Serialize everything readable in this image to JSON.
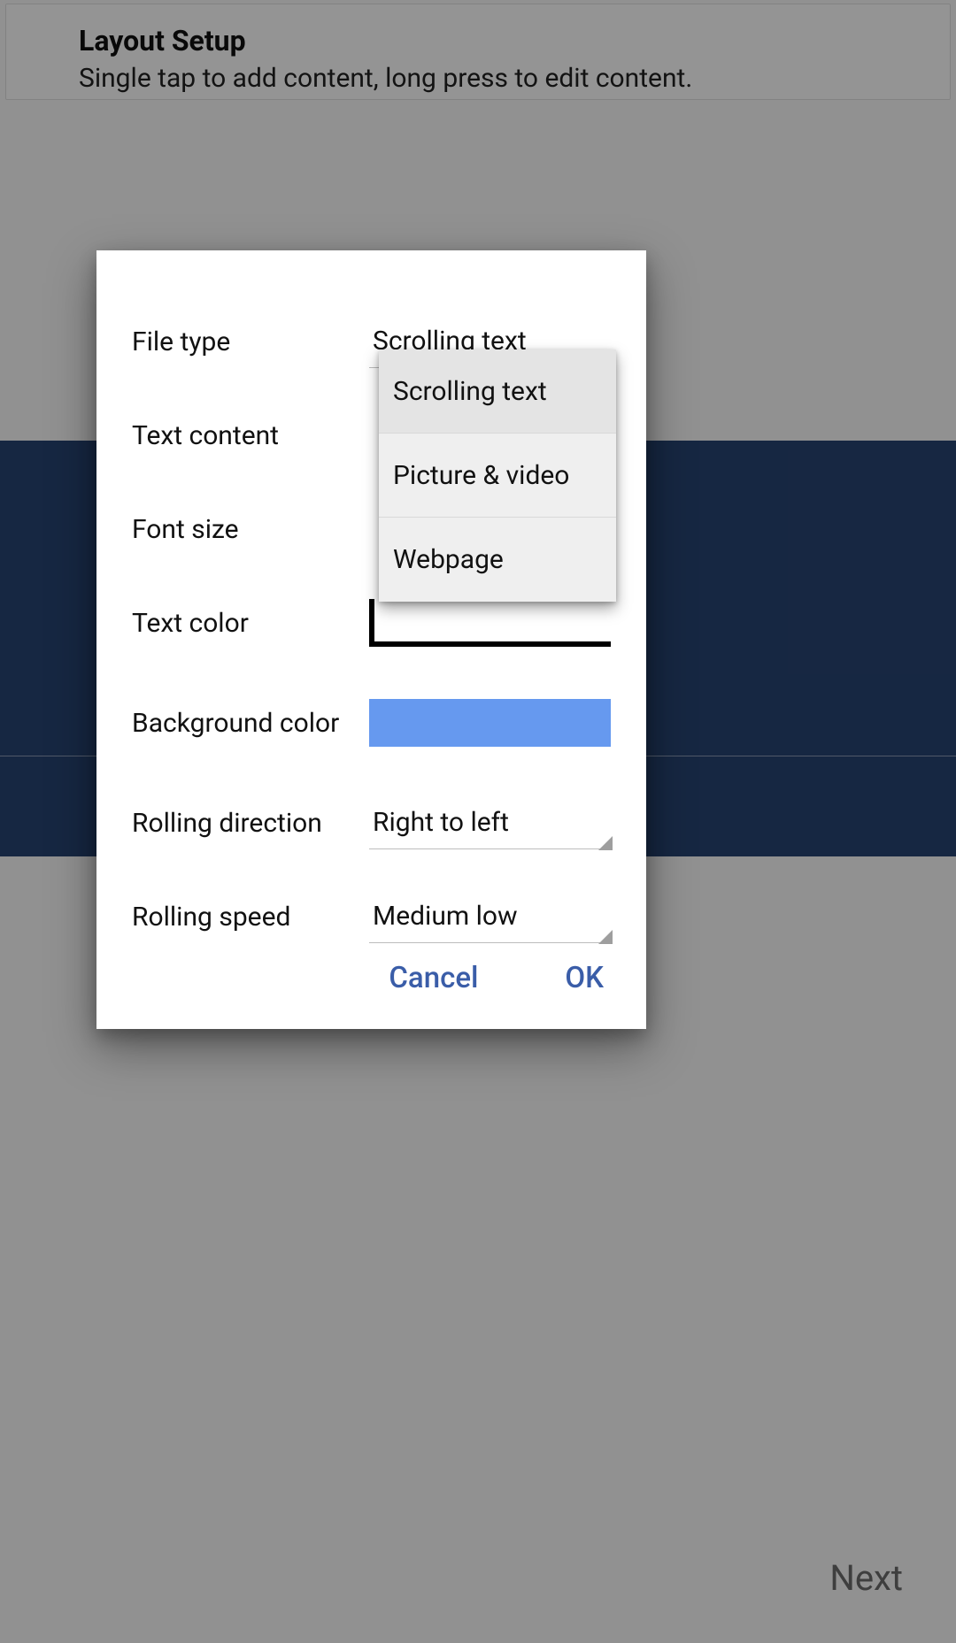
{
  "header": {
    "title": "Layout Setup",
    "subtitle": "Single tap to add content, long press to edit content."
  },
  "footer": {
    "next": "Next"
  },
  "dialog": {
    "rows": {
      "file_type": {
        "label": "File type",
        "value": "Scrolling text"
      },
      "text_content": {
        "label": "Text content"
      },
      "font_size": {
        "label": "Font size"
      },
      "text_color": {
        "label": "Text color",
        "value_hex": "#ffffff"
      },
      "background_color": {
        "label": "Background color",
        "value_hex": "#6699ef"
      },
      "rolling_direction": {
        "label": "Rolling direction",
        "value": "Right to left"
      },
      "rolling_speed": {
        "label": "Rolling speed",
        "value": "Medium low"
      }
    },
    "actions": {
      "cancel": "Cancel",
      "ok": "OK"
    }
  },
  "dropdown": {
    "options": [
      "Scrolling text",
      "Picture & video",
      "Webpage"
    ],
    "selected": "Scrolling text"
  }
}
